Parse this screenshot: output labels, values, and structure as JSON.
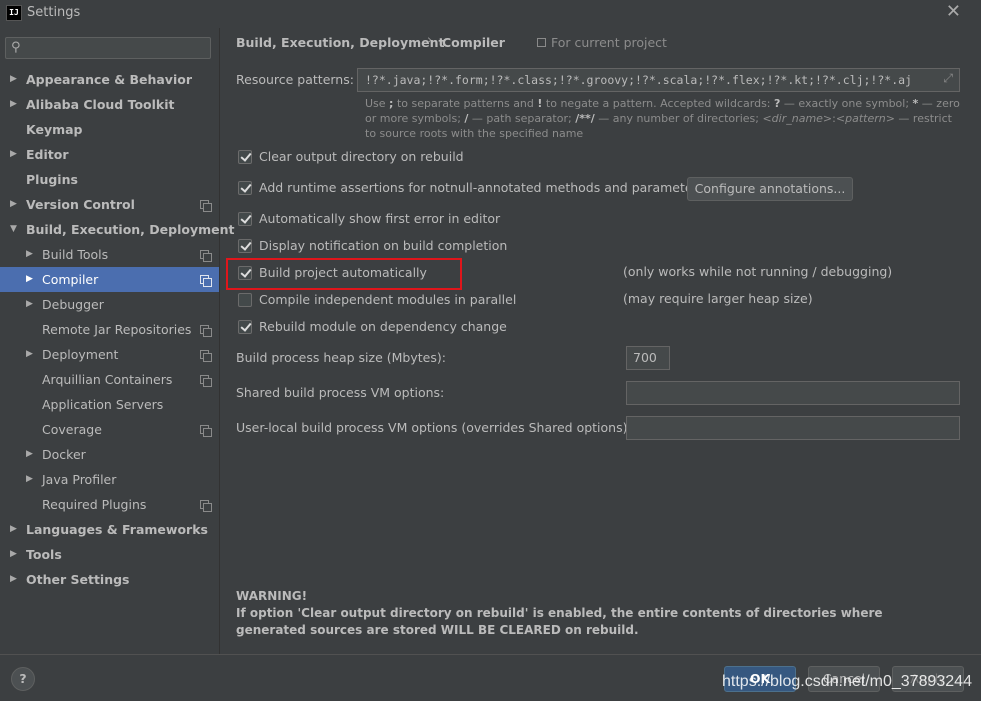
{
  "window": {
    "title": "Settings",
    "app_icon_text": "IJ",
    "close_glyph": "✕"
  },
  "search": {
    "placeholder": "",
    "value": ""
  },
  "tree": [
    {
      "label": "Appearance & Behavior",
      "level": 0,
      "arrow": "▶",
      "bold": true,
      "selected": false,
      "proj": false
    },
    {
      "label": "Alibaba Cloud Toolkit",
      "level": 0,
      "arrow": "▶",
      "bold": true,
      "selected": false,
      "proj": false
    },
    {
      "label": "Keymap",
      "level": 0,
      "arrow": "",
      "bold": true,
      "selected": false,
      "proj": false
    },
    {
      "label": "Editor",
      "level": 0,
      "arrow": "▶",
      "bold": true,
      "selected": false,
      "proj": false
    },
    {
      "label": "Plugins",
      "level": 0,
      "arrow": "",
      "bold": true,
      "selected": false,
      "proj": false
    },
    {
      "label": "Version Control",
      "level": 0,
      "arrow": "▶",
      "bold": true,
      "selected": false,
      "proj": true
    },
    {
      "label": "Build, Execution, Deployment",
      "level": 0,
      "arrow": "▼",
      "bold": true,
      "selected": false,
      "proj": false
    },
    {
      "label": "Build Tools",
      "level": 1,
      "arrow": "▶",
      "bold": false,
      "selected": false,
      "proj": true
    },
    {
      "label": "Compiler",
      "level": 1,
      "arrow": "▶",
      "bold": false,
      "selected": true,
      "proj": true
    },
    {
      "label": "Debugger",
      "level": 1,
      "arrow": "▶",
      "bold": false,
      "selected": false,
      "proj": false
    },
    {
      "label": "Remote Jar Repositories",
      "level": 1,
      "arrow": "",
      "bold": false,
      "selected": false,
      "proj": true
    },
    {
      "label": "Deployment",
      "level": 1,
      "arrow": "▶",
      "bold": false,
      "selected": false,
      "proj": true
    },
    {
      "label": "Arquillian Containers",
      "level": 1,
      "arrow": "",
      "bold": false,
      "selected": false,
      "proj": true
    },
    {
      "label": "Application Servers",
      "level": 1,
      "arrow": "",
      "bold": false,
      "selected": false,
      "proj": false
    },
    {
      "label": "Coverage",
      "level": 1,
      "arrow": "",
      "bold": false,
      "selected": false,
      "proj": true
    },
    {
      "label": "Docker",
      "level": 1,
      "arrow": "▶",
      "bold": false,
      "selected": false,
      "proj": false
    },
    {
      "label": "Java Profiler",
      "level": 1,
      "arrow": "▶",
      "bold": false,
      "selected": false,
      "proj": false
    },
    {
      "label": "Required Plugins",
      "level": 1,
      "arrow": "",
      "bold": false,
      "selected": false,
      "proj": true
    },
    {
      "label": "Languages & Frameworks",
      "level": 0,
      "arrow": "▶",
      "bold": true,
      "selected": false,
      "proj": false
    },
    {
      "label": "Tools",
      "level": 0,
      "arrow": "▶",
      "bold": true,
      "selected": false,
      "proj": false
    },
    {
      "label": "Other Settings",
      "level": 0,
      "arrow": "▶",
      "bold": true,
      "selected": false,
      "proj": false
    }
  ],
  "breadcrumb": {
    "parent": "Build, Execution, Deployment",
    "separator": "›",
    "current": "Compiler",
    "scope": "For current project"
  },
  "resource_patterns": {
    "label": "Resource patterns:",
    "value": "!?*.java;!?*.form;!?*.class;!?*.groovy;!?*.scala;!?*.flex;!?*.kt;!?*.clj;!?*.aj",
    "expand_glyph": "⤢"
  },
  "hint": {
    "p1": "Use ",
    "semi": ";",
    "p2": " to separate patterns and ",
    "bang": "!",
    "p3": " to negate a pattern. Accepted wildcards: ",
    "q": "?",
    "p4": " — exactly one symbol; ",
    "star": "*",
    "p5": " — zero or more symbols; ",
    "slash": "/",
    "p6": " — path separator; ",
    "dstar": "/**/",
    "p7": " — any number of directories; ",
    "dirname": "<dir_name>",
    "colon": ":",
    "pattern": "<pattern>",
    "p8": " — restrict to source roots with the specified name"
  },
  "options": [
    {
      "label": "Clear output directory on rebuild",
      "checked": true
    },
    {
      "label": "Add runtime assertions for notnull-annotated methods and parameters",
      "checked": true
    },
    {
      "label": "Automatically show first error in editor",
      "checked": true
    },
    {
      "label": "Display notification on build completion",
      "checked": true
    },
    {
      "label": "Build project automatically",
      "checked": true
    },
    {
      "label": "Compile independent modules in parallel",
      "checked": false
    },
    {
      "label": "Rebuild module on dependency change",
      "checked": true
    }
  ],
  "configure_annotations_label": "Configure annotations...",
  "notes": {
    "build_auto": "(only works while not running / debugging)",
    "parallel": "(may require larger heap size)"
  },
  "heap": {
    "label": "Build process heap size (Mbytes):",
    "value": "700"
  },
  "shared_vm": {
    "label": "Shared build process VM options:",
    "value": ""
  },
  "user_vm": {
    "label": "User-local build process VM options (overrides Shared options):",
    "value": ""
  },
  "warning": {
    "title": "WARNING!",
    "body": "If option 'Clear output directory on rebuild' is enabled, the entire contents of directories where generated sources are stored WILL BE CLEARED on rebuild."
  },
  "footer": {
    "help": "?",
    "ok": "OK",
    "cancel": "Cancel",
    "apply": "Apply",
    "watermark": "https://blog.csdn.net/m0_37893244"
  },
  "colors": {
    "background": "#3c3f41",
    "selection": "#4b6eaf",
    "highlight_box": "#e0161b",
    "ok_button": "#365880"
  }
}
